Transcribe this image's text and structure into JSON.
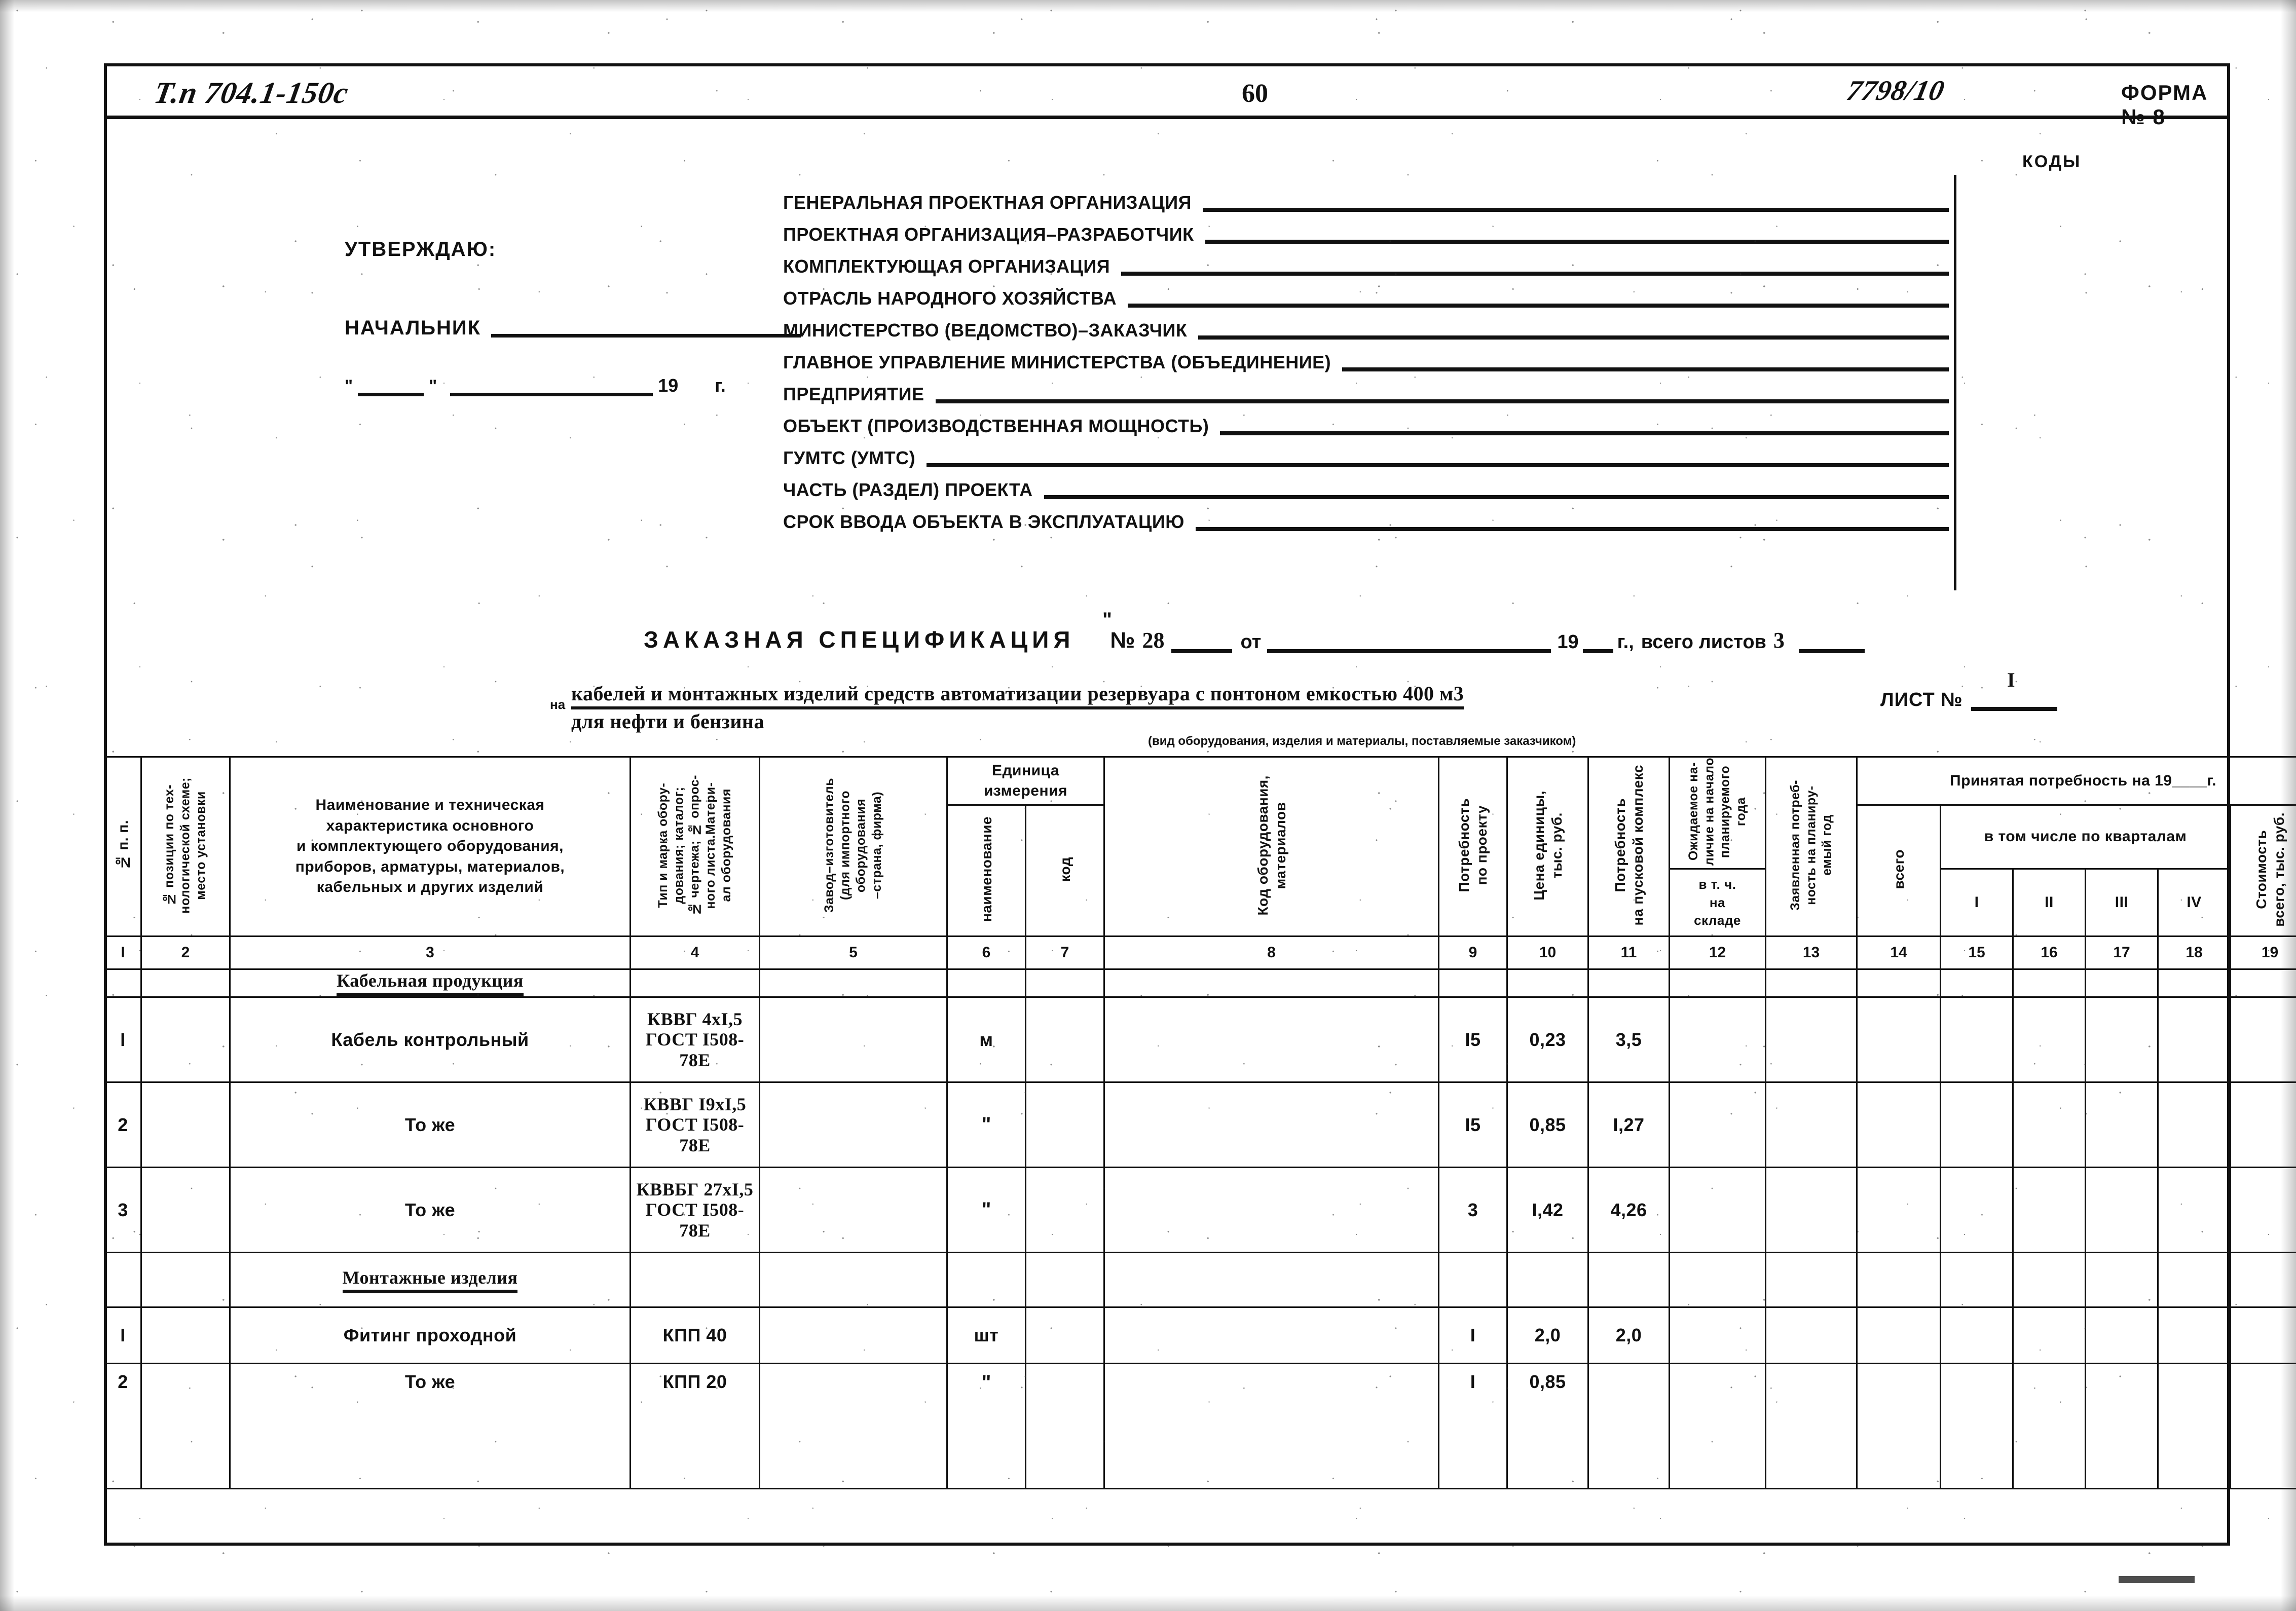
{
  "header": {
    "project_code_handwritten": "Т.п 704.1-150с",
    "page_number": "60",
    "doc_number_handwritten": "7798/10",
    "form_label": "ФОРМА № 8",
    "codes_label": "КОДЫ"
  },
  "approval": {
    "title": "УТВЕРЖДАЮ:",
    "chief_label": "НАЧАЛЬНИК",
    "quote_open": "\"",
    "quote_close": "\"",
    "year_prefix": "19",
    "year_suffix": "г."
  },
  "org_fields": [
    {
      "label": "ГЕНЕРАЛЬНАЯ ПРОЕКТНАЯ ОРГАНИЗАЦИЯ",
      "value": ""
    },
    {
      "label": "ПРОЕКТНАЯ ОРГАНИЗАЦИЯ–РАЗРАБОТЧИК",
      "value": ""
    },
    {
      "label": "КОМПЛЕКТУЮЩАЯ ОРГАНИЗАЦИЯ",
      "value": ""
    },
    {
      "label": "ОТРАСЛЬ НАРОДНОГО ХОЗЯЙСТВА",
      "value": ""
    },
    {
      "label": "МИНИСТЕРСТВО (ВЕДОМСТВО)–ЗАКАЗЧИК",
      "value": ""
    },
    {
      "label": "ГЛАВНОЕ УПРАВЛЕНИЕ МИНИСТЕРСТВА (ОБЪЕДИНЕНИЕ)",
      "value": ""
    },
    {
      "label": "ПРЕДПРИЯТИЕ",
      "value": ""
    },
    {
      "label": "ОБЪЕКТ (ПРОИЗВОДСТВЕННАЯ МОЩНОСТЬ)",
      "value": ""
    },
    {
      "label": "ГУМТС (УМТС)",
      "value": ""
    },
    {
      "label": "ЧАСТЬ (РАЗДЕЛ) ПРОЕКТА",
      "value": ""
    },
    {
      "label": "СРОК ВВОДА ОБЪЕКТА В ЭКСПЛУАТАЦИЮ",
      "value": ""
    }
  ],
  "spec_title": {
    "title": "ЗАКАЗНАЯ СПЕЦИФИКАЦИЯ",
    "number_symbol": "№",
    "number_value": "28",
    "from_label": "от",
    "year_prefix": "19",
    "year_suffix": "г.,",
    "total_sheets_label": "всего листов",
    "total_sheets_value": "3",
    "quote": "\""
  },
  "subject": {
    "na_prefix": "на",
    "line1": "кабелей и монтажных изделий средств автоматизации резервуара с понтоном емкостью 400 м3",
    "line2": "для нефти и бензина",
    "caption": "(вид оборудования, изделия и материалы, поставляемые заказчиком)",
    "sheet_label": "ЛИСТ №",
    "sheet_value": "I"
  },
  "table": {
    "headers": {
      "c1": "№ п. п.",
      "c2": "№ позиции по тех-\nнологической схеме;\nместо установки",
      "c3": "Наименование  и техническая\nхарактеристика основного\nи комплектующего оборудования,\nприборов, арматуры, материалов,\nкабельных и других изделий",
      "c4": "Тип и марка обору-\nдования; каталог;\n№ чертежа; № опрос-\nного листа.Матери-\nал оборудования",
      "c5": "Завод–изготовитель\n(для импортного\nоборудования\n–страна, фирма)",
      "unit_group": "Единица\nизмерения",
      "c6": "наименование",
      "c7": "код",
      "c8": "Код оборудования,\nматериалов",
      "c9": "Потребность\nпо проекту",
      "c10": "Цена единицы,\nтыс. руб.",
      "c11": "Потребность\nна пусковой комплекс",
      "c12": "Ожидаемое на-\nличие на начало\nпланируемого\nгода",
      "c12sub": "в т. ч.\nна\nскладе",
      "c13": "Заявленная потреб-\nность на планиру-\nемый год",
      "accepted_group": "Принятая потребность на 19____г.",
      "c14": "всего",
      "quarters_group": "в том числе  по кварталам",
      "c15": "I",
      "c16": "II",
      "c17": "III",
      "c18": "IV",
      "c19": "Стоимость\nвсего, тыс. руб."
    },
    "column_numbers": [
      "I",
      "2",
      "3",
      "4",
      "5",
      "6",
      "7",
      "8",
      "9",
      "10",
      "11",
      "12",
      "13",
      "14",
      "15",
      "16",
      "17",
      "18",
      "19"
    ],
    "rows": [
      {
        "kind": "group",
        "no": "",
        "pos": "",
        "name": "Кабельная продукция",
        "type": "",
        "maker": "",
        "unit": "",
        "unit_code": "",
        "mat_code": "",
        "need_project": "",
        "unit_price": "",
        "need_startup": "",
        "expected": "",
        "in_store": "",
        "declared": "",
        "total": "",
        "q1": "",
        "q2": "",
        "q3": "",
        "q4": "",
        "cost": ""
      },
      {
        "kind": "item",
        "no": "I",
        "pos": "",
        "name": "Кабель контрольный",
        "type": "КВВГ 4хI,5\nГОСТ I508-78E",
        "maker": "",
        "unit": "м",
        "unit_code": "",
        "mat_code": "",
        "need_project": "I5",
        "unit_price": "0,23",
        "need_startup": "3,5",
        "expected": "",
        "in_store": "",
        "declared": "",
        "total": "",
        "q1": "",
        "q2": "",
        "q3": "",
        "q4": "",
        "cost": ""
      },
      {
        "kind": "item",
        "no": "2",
        "pos": "",
        "name": "То же",
        "type": "КВВГ I9хI,5\nГОСТ I508-78E",
        "maker": "",
        "unit": "\"",
        "unit_code": "",
        "mat_code": "",
        "need_project": "I5",
        "unit_price": "0,85",
        "need_startup": "I,27",
        "expected": "",
        "in_store": "",
        "declared": "",
        "total": "",
        "q1": "",
        "q2": "",
        "q3": "",
        "q4": "",
        "cost": ""
      },
      {
        "kind": "item",
        "no": "3",
        "pos": "",
        "name": "То же",
        "type": "КВВБГ 27хI,5\nГОСТ I508-78E",
        "maker": "",
        "unit": "\"",
        "unit_code": "",
        "mat_code": "",
        "need_project": "3",
        "unit_price": "I,42",
        "need_startup": "4,26",
        "expected": "",
        "in_store": "",
        "declared": "",
        "total": "",
        "q1": "",
        "q2": "",
        "q3": "",
        "q4": "",
        "cost": ""
      },
      {
        "kind": "group",
        "no": "",
        "pos": "",
        "name": "Монтажные изделия",
        "type": "",
        "maker": "",
        "unit": "",
        "unit_code": "",
        "mat_code": "",
        "need_project": "",
        "unit_price": "",
        "need_startup": "",
        "expected": "",
        "in_store": "",
        "declared": "",
        "total": "",
        "q1": "",
        "q2": "",
        "q3": "",
        "q4": "",
        "cost": ""
      },
      {
        "kind": "item",
        "no": "I",
        "pos": "",
        "name": "Фитинг проходной",
        "type": "КПП 40",
        "maker": "",
        "unit": "шт",
        "unit_code": "",
        "mat_code": "",
        "need_project": "I",
        "unit_price": "2,0",
        "need_startup": "2,0",
        "expected": "",
        "in_store": "",
        "declared": "",
        "total": "",
        "q1": "",
        "q2": "",
        "q3": "",
        "q4": "",
        "cost": ""
      },
      {
        "kind": "item",
        "no": "2",
        "pos": "",
        "name": "То же",
        "type": "КПП 20",
        "maker": "",
        "unit": "\"",
        "unit_code": "",
        "mat_code": "",
        "need_project": "I",
        "unit_price": "0,85",
        "need_startup": "",
        "expected": "",
        "in_store": "",
        "declared": "",
        "total": "",
        "q1": "",
        "q2": "",
        "q3": "",
        "q4": "",
        "cost": ""
      }
    ]
  }
}
